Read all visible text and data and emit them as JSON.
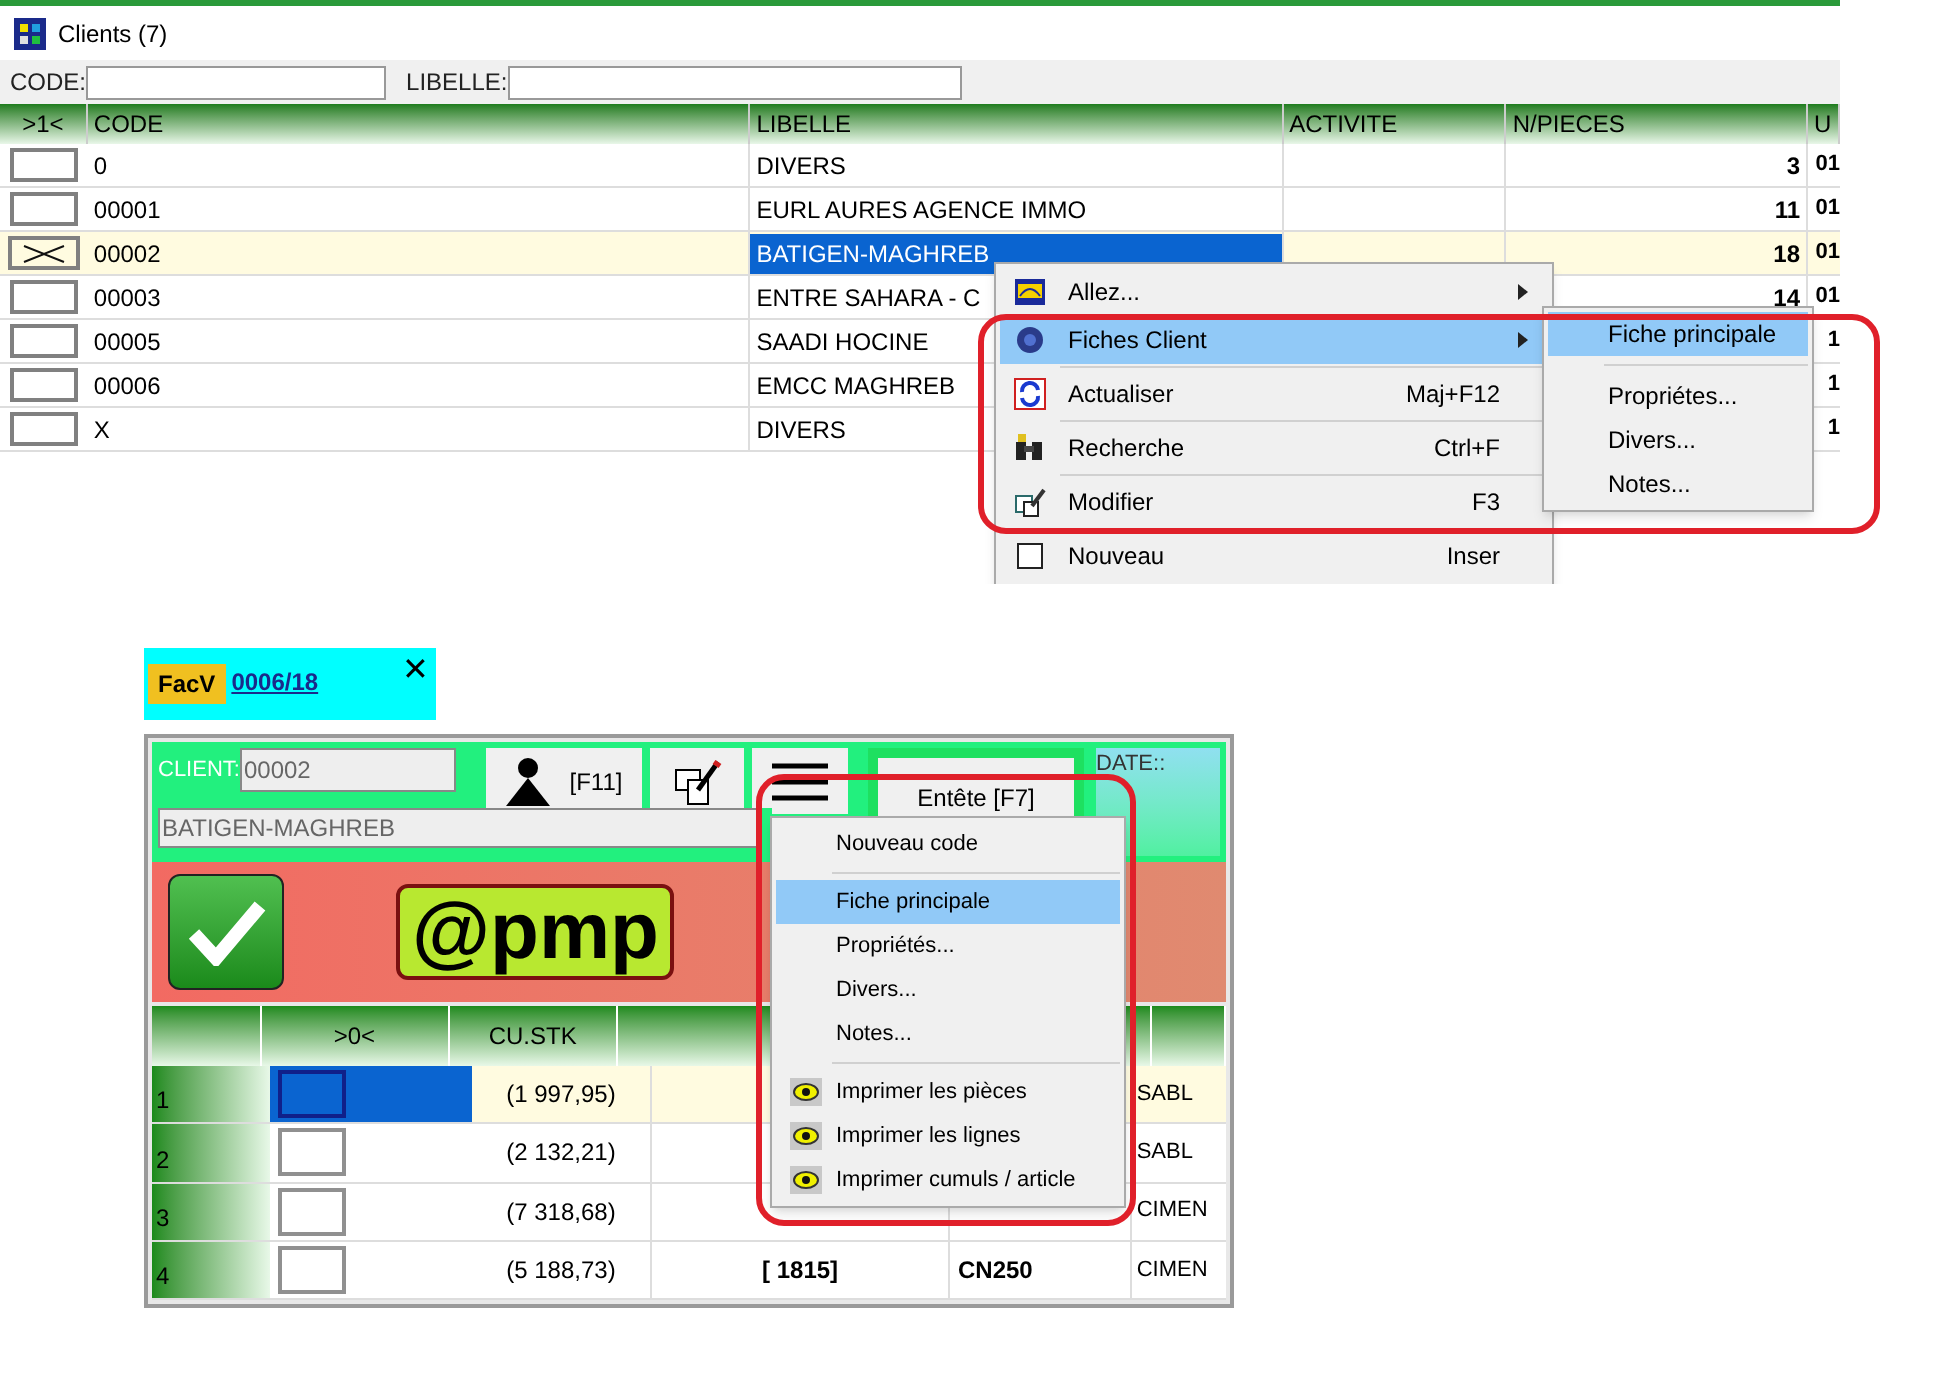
{
  "clients_window": {
    "title": "Clients (7)",
    "filters": [
      {
        "label": "CODE:"
      },
      {
        "label": "LIBELLE:"
      }
    ],
    "columns": [
      ">1<",
      "CODE",
      "LIBELLE",
      "ACTIVITE",
      "N/PIECES",
      "U"
    ],
    "rows": [
      {
        "selected": false,
        "code": "0",
        "libelle": "DIVERS",
        "n_pieces": "3",
        "column_6": "01"
      },
      {
        "selected": false,
        "code": "00001",
        "libelle": "EURL AURES AGENCE IMMO",
        "n_pieces": "11",
        "column_6": "01"
      },
      {
        "selected": true,
        "code": "00002",
        "libelle": "BATIGEN-MAGHREB",
        "n_pieces": "18",
        "column_6": "01"
      },
      {
        "selected": false,
        "code": "00003",
        "libelle": "ENTRE SAHARA - C",
        "n_pieces": "14",
        "column_6": "01"
      },
      {
        "selected": false,
        "code": "00005",
        "libelle": "SAADI HOCINE",
        "column_6": "1"
      },
      {
        "selected": false,
        "code": "00006",
        "libelle": "EMCC MAGHREB",
        "column_6": "1"
      },
      {
        "selected": false,
        "code": "X",
        "libelle": "DIVERS",
        "column_6": "1"
      }
    ]
  },
  "context_menu": {
    "items": [
      {
        "kind": "goto",
        "label": "Allez...",
        "submenu": true,
        "selected": false
      },
      {
        "kind": "card",
        "label": "Fiches Client",
        "submenu": true,
        "selected": true
      },
      {
        "kind": "refresh",
        "label": "Actualiser",
        "shortcut": "Maj+F12",
        "submenu": false,
        "selected": false
      },
      {
        "kind": "search",
        "label": "Recherche",
        "shortcut": "Ctrl+F",
        "submenu": false,
        "selected": false
      },
      {
        "kind": "edit",
        "label": "Modifier",
        "shortcut": "F3",
        "submenu": false,
        "selected": false
      },
      {
        "kind": "new",
        "label": "Nouveau",
        "shortcut": "Inser",
        "submenu": false,
        "selected": false
      }
    ]
  },
  "submenu": {
    "items": [
      {
        "label": "Fiche principale",
        "selected": true
      },
      {
        "label": "Propriétes...",
        "selected": false
      },
      {
        "label": "Divers...",
        "selected": false
      },
      {
        "label": "Notes...",
        "selected": false
      }
    ]
  },
  "invoice_tab": {
    "badge": "FacV",
    "number": "0006/18",
    "close": "✕"
  },
  "invoice_form": {
    "client_label": "CLIENT:",
    "client_code": "00002",
    "client_name": "BATIGEN-MAGHREB",
    "client_button": "[F11]",
    "header_button": "Entête [F7]",
    "date_label": "DATE::",
    "logo": "@pmp",
    "columns": [
      "",
      ">0<",
      "CU.STK",
      "",
      "",
      "",
      ""
    ],
    "rows": [
      {
        "number": "1",
        "selected": true,
        "cu_stk": "(1 997,95)",
        "column_7": "SABL"
      },
      {
        "number": "2",
        "selected": false,
        "cu_stk": "(2 132,21)",
        "column_7": "SABL"
      },
      {
        "number": "3",
        "selected": false,
        "cu_stk": "(7 318,68)",
        "column_7": "CIMEN"
      },
      {
        "number": "4",
        "selected": false,
        "cu_stk": "(5 188,73)",
        "column_4": "[ 1815]",
        "column_5": "CN250",
        "column_7": "CIMEN"
      }
    ]
  },
  "dropdown_menu": {
    "items": [
      {
        "kind": "plain",
        "label": "Nouveau code",
        "selected": false
      },
      {
        "kind": "separator"
      },
      {
        "kind": "plain",
        "label": "Fiche principale",
        "selected": true
      },
      {
        "kind": "plain",
        "label": "Propriétés...",
        "selected": false
      },
      {
        "kind": "plain",
        "label": "Divers...",
        "selected": false
      },
      {
        "kind": "plain",
        "label": "Notes...",
        "selected": false
      },
      {
        "kind": "separator"
      },
      {
        "kind": "print",
        "label": "Imprimer les pièces",
        "selected": false
      },
      {
        "kind": "print",
        "label": "Imprimer les lignes",
        "selected": false
      },
      {
        "kind": "print",
        "label": "Imprimer cumuls / article",
        "selected": false
      }
    ]
  }
}
